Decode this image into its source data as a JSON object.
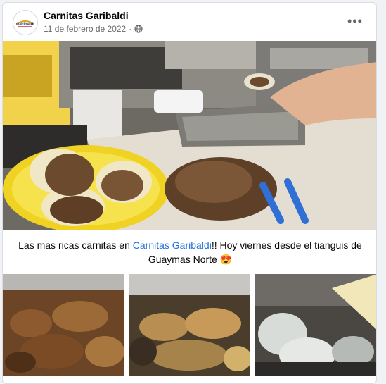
{
  "post": {
    "page_name": "Carnitas Garibaldi",
    "date": "11 de febrero de 2022",
    "separator": "·",
    "audience_icon": "globe-icon",
    "more_label": "•••",
    "avatar_text": "Garibaldi"
  },
  "caption": {
    "before": "Las mas ricas carnitas en ",
    "link": "Carnitas Garibaldi",
    "after": "!! Hoy viernes desde el tianguis de Guaymas Norte ",
    "emoji": "😍"
  },
  "colors": {
    "link": "#216fdb",
    "background": "#f0f2f5",
    "card": "#ffffff"
  }
}
